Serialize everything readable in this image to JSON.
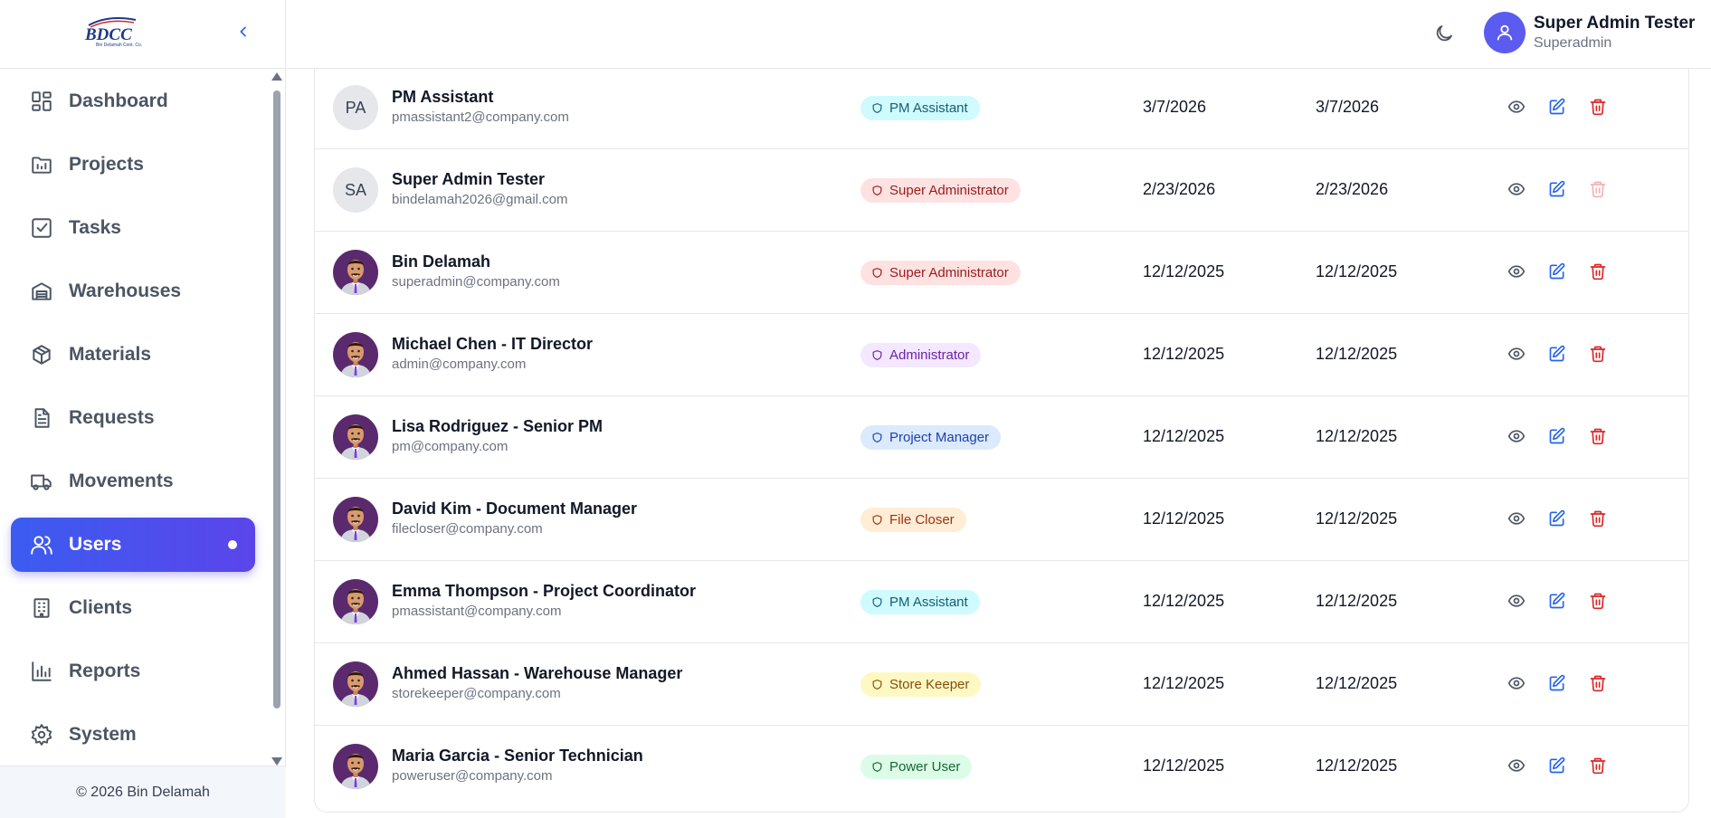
{
  "sidebar": {
    "logo_text": "BDCC",
    "logo_subtext": "Bin Delamah Cont. Co.",
    "items": [
      {
        "label": "Dashboard",
        "icon": "dashboard-icon"
      },
      {
        "label": "Projects",
        "icon": "folder-icon"
      },
      {
        "label": "Tasks",
        "icon": "check-square-icon"
      },
      {
        "label": "Warehouses",
        "icon": "warehouse-icon"
      },
      {
        "label": "Materials",
        "icon": "package-icon"
      },
      {
        "label": "Requests",
        "icon": "file-text-icon"
      },
      {
        "label": "Movements",
        "icon": "truck-icon"
      },
      {
        "label": "Users",
        "icon": "users-icon",
        "active": true
      },
      {
        "label": "Clients",
        "icon": "building-icon"
      },
      {
        "label": "Reports",
        "icon": "bar-chart-icon"
      },
      {
        "label": "System",
        "icon": "gear-icon"
      }
    ],
    "footer": "© 2026 Bin Delamah"
  },
  "header": {
    "user_name": "Super Admin Tester",
    "user_role": "Superadmin"
  },
  "colors": {
    "accent": "#4f46e5",
    "view_icon": "#4b5563",
    "edit_icon": "#2563eb",
    "delete_icon": "#dc2626"
  },
  "users": [
    {
      "initials": "PA",
      "name": "PM Assistant",
      "email": "pmassistant2@company.com",
      "role": "PM Assistant",
      "role_style": "cyan",
      "created": "3/7/2026",
      "updated": "3/7/2026",
      "avatar": "initials",
      "delete_disabled": false
    },
    {
      "initials": "SA",
      "name": "Super Admin Tester",
      "email": "bindelamah2026@gmail.com",
      "role": "Super Administrator",
      "role_style": "red",
      "created": "2/23/2026",
      "updated": "2/23/2026",
      "avatar": "initials",
      "delete_disabled": true
    },
    {
      "name": "Bin Delamah",
      "email": "superadmin@company.com",
      "role": "Super Administrator",
      "role_style": "red",
      "created": "12/12/2025",
      "updated": "12/12/2025",
      "avatar": "photo",
      "delete_disabled": false
    },
    {
      "name": "Michael Chen - IT Director",
      "email": "admin@company.com",
      "role": "Administrator",
      "role_style": "purple",
      "created": "12/12/2025",
      "updated": "12/12/2025",
      "avatar": "photo",
      "delete_disabled": false
    },
    {
      "name": "Lisa Rodriguez - Senior PM",
      "email": "pm@company.com",
      "role": "Project Manager",
      "role_style": "blue",
      "created": "12/12/2025",
      "updated": "12/12/2025",
      "avatar": "photo",
      "delete_disabled": false
    },
    {
      "name": "David Kim - Document Manager",
      "email": "filecloser@company.com",
      "role": "File Closer",
      "role_style": "orange",
      "created": "12/12/2025",
      "updated": "12/12/2025",
      "avatar": "photo",
      "delete_disabled": false
    },
    {
      "name": "Emma Thompson - Project Coordinator",
      "email": "pmassistant@company.com",
      "role": "PM Assistant",
      "role_style": "cyan",
      "created": "12/12/2025",
      "updated": "12/12/2025",
      "avatar": "photo",
      "delete_disabled": false
    },
    {
      "name": "Ahmed Hassan - Warehouse Manager",
      "email": "storekeeper@company.com",
      "role": "Store Keeper",
      "role_style": "yellow",
      "created": "12/12/2025",
      "updated": "12/12/2025",
      "avatar": "photo",
      "delete_disabled": false
    },
    {
      "name": "Maria Garcia - Senior Technician",
      "email": "poweruser@company.com",
      "role": "Power User",
      "role_style": "green",
      "created": "12/12/2025",
      "updated": "12/12/2025",
      "avatar": "photo",
      "delete_disabled": false
    }
  ],
  "badge_styles": {
    "cyan": {
      "bg": "#cffafe",
      "fg": "#155e75"
    },
    "red": {
      "bg": "#fee2e2",
      "fg": "#991b1b"
    },
    "purple": {
      "bg": "#f3e8ff",
      "fg": "#6b21a8"
    },
    "blue": {
      "bg": "#dbeafe",
      "fg": "#1e40af"
    },
    "orange": {
      "bg": "#ffedd5",
      "fg": "#9a3412"
    },
    "yellow": {
      "bg": "#fef9c3",
      "fg": "#854d0e"
    },
    "green": {
      "bg": "#dcfce7",
      "fg": "#166534"
    }
  }
}
